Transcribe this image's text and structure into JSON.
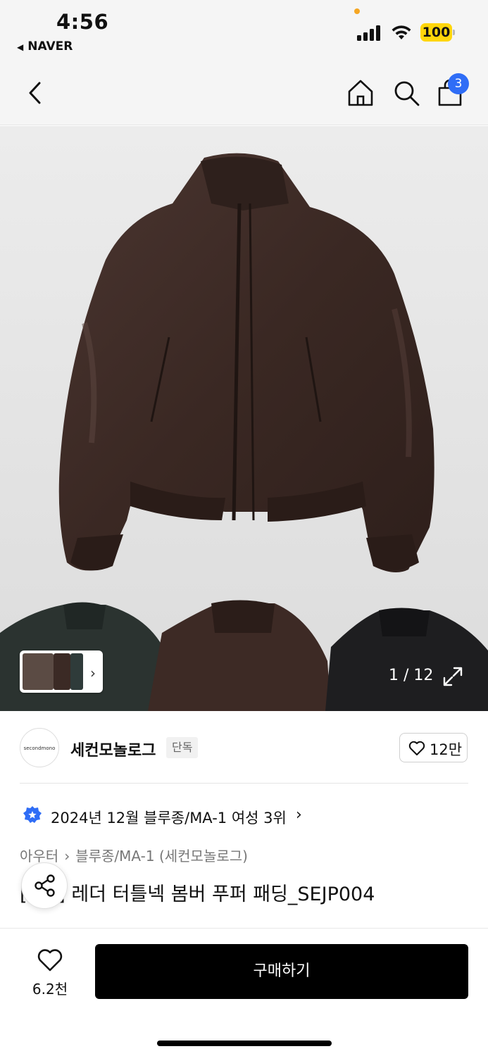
{
  "status_bar": {
    "time": "4:56",
    "back_app": "NAVER",
    "battery": "100",
    "battery_color": "#ffd60a"
  },
  "nav": {
    "cart_count": "3",
    "badge_color": "#2f6df6",
    "icons": [
      "chevron-left-icon",
      "home-icon",
      "search-icon",
      "shopping-bag-icon"
    ]
  },
  "gallery": {
    "counter": "1 / 12",
    "thumbnails": [
      "jacket-model-thumb",
      "brown-jacket-thumb",
      "green-jacket-thumb"
    ],
    "expand_icon": "expand-icon"
  },
  "seller": {
    "logo_text": "secondmono",
    "name": "세컨모놀로그",
    "badge": "단독",
    "likes": "12만"
  },
  "ranking": {
    "text": "2024년 12월 블루종/MA-1 여성 3위"
  },
  "breadcrumb": {
    "items": [
      "아우터",
      "블루종/MA-1 (세컨모놀로그)"
    ]
  },
  "product": {
    "title": "[ lor] 레더 터틀넥 봄버 푸퍼 패딩_SEJP004"
  },
  "bottom_bar": {
    "wish_count": "6.2천",
    "buy_label": "구매하기"
  }
}
